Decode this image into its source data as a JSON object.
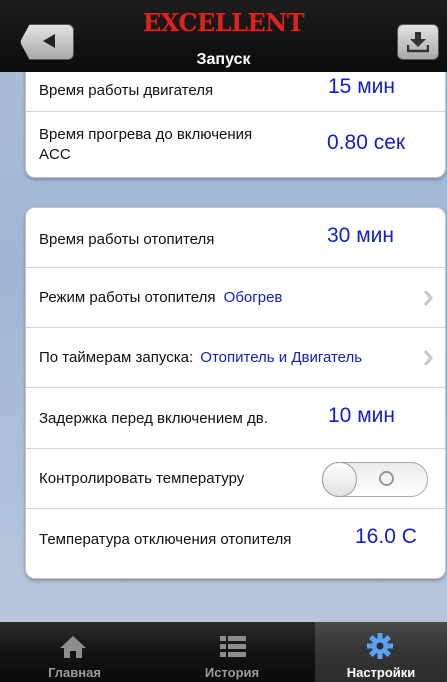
{
  "app": {
    "logo": "EXCELLENT",
    "title": "Запуск"
  },
  "card1": {
    "engine_time": {
      "label": "Время работы двигателя",
      "value": "15 мин"
    },
    "warmup_time": {
      "label_line1": "Время прогрева до включения",
      "label_line2": "ACC",
      "value": "0.80 сек"
    }
  },
  "card2": {
    "heater_time": {
      "label": "Время работы отопителя",
      "value": "30 мин"
    },
    "heater_mode": {
      "label": "Режим работы отопителя",
      "value": "Обогрев"
    },
    "timer_launch": {
      "label": "По таймерам запуска:",
      "value": "Отопитель и Двигатель"
    },
    "delay": {
      "label": "Задержка перед включением дв.",
      "value": "10 мин"
    },
    "control_temp": {
      "label": "Контролировать температуру",
      "toggle_on": false
    },
    "shutdown_temp": {
      "label": "Температура отключения отопителя",
      "value": "16.0 С"
    }
  },
  "tabs": [
    {
      "label": "Главная",
      "icon": "home-icon",
      "selected": false
    },
    {
      "label": "История",
      "icon": "list-icon",
      "selected": false
    },
    {
      "label": "Настройки",
      "icon": "gear-icon",
      "selected": true
    }
  ],
  "colors": {
    "value_blue": "#1320c9",
    "logo_red": "#d7261f"
  }
}
